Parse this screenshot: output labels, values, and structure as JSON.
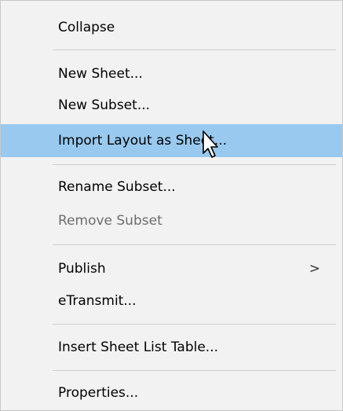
{
  "menu": {
    "items": [
      {
        "label": "Collapse"
      },
      {
        "label": "New Sheet..."
      },
      {
        "label": "New Subset..."
      },
      {
        "label": "Import Layout as Sheet..."
      },
      {
        "label": "Rename Subset..."
      },
      {
        "label": "Remove Subset"
      },
      {
        "label": "Publish",
        "submenu_arrow": ">"
      },
      {
        "label": "eTransmit..."
      },
      {
        "label": "Insert Sheet List Table..."
      },
      {
        "label": "Properties..."
      }
    ]
  },
  "colors": {
    "menu_background": "#f2f2f2",
    "hover_highlight": "#99c9ef",
    "disabled_text": "#6d6d6d",
    "separator": "#cfcfcf"
  },
  "icons": {
    "cursor": "arrow-pointer-icon",
    "submenu": "chevron-right-icon"
  }
}
